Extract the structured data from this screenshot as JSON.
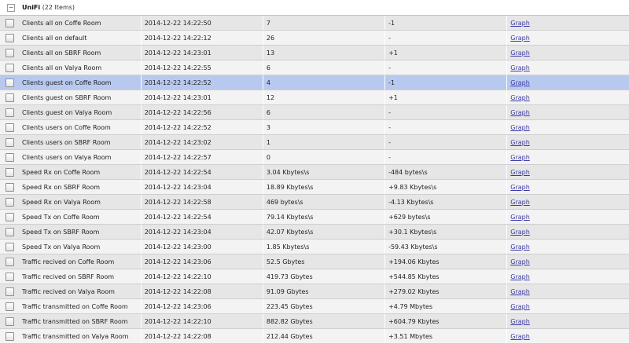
{
  "group": {
    "expander_glyph": "−",
    "title": "UniFi",
    "count_label": "(22 Items)"
  },
  "rows": [
    {
      "name": "Clients all on Coffe Room",
      "time": "2014-12-22 14:22:50",
      "value": "7",
      "change": "-1",
      "link": "Graph"
    },
    {
      "name": "Clients all on default",
      "time": "2014-12-22 14:22:12",
      "value": "26",
      "change": "-",
      "link": "Graph"
    },
    {
      "name": "Clients all on SBRF Room",
      "time": "2014-12-22 14:23:01",
      "value": "13",
      "change": "+1",
      "link": "Graph"
    },
    {
      "name": "Clients all on Valya Room",
      "time": "2014-12-22 14:22:55",
      "value": "6",
      "change": "-",
      "link": "Graph"
    },
    {
      "name": "Clients guest on Coffe Room",
      "time": "2014-12-22 14:22:52",
      "value": "4",
      "change": "-1",
      "link": "Graph",
      "selected": true
    },
    {
      "name": "Clients guest on SBRF Room",
      "time": "2014-12-22 14:23:01",
      "value": "12",
      "change": "+1",
      "link": "Graph"
    },
    {
      "name": "Clients guest on Valya Room",
      "time": "2014-12-22 14:22:56",
      "value": "6",
      "change": "-",
      "link": "Graph"
    },
    {
      "name": "Clients users on Coffe Room",
      "time": "2014-12-22 14:22:52",
      "value": "3",
      "change": "-",
      "link": "Graph"
    },
    {
      "name": "Clients users on SBRF Room",
      "time": "2014-12-22 14:23:02",
      "value": "1",
      "change": "-",
      "link": "Graph"
    },
    {
      "name": "Clients users on Valya Room",
      "time": "2014-12-22 14:22:57",
      "value": "0",
      "change": "-",
      "link": "Graph"
    },
    {
      "name": "Speed Rx on Coffe Room",
      "time": "2014-12-22 14:22:54",
      "value": "3.04 Kbytes\\s",
      "change": "-484 bytes\\s",
      "link": "Graph"
    },
    {
      "name": "Speed Rx on SBRF Room",
      "time": "2014-12-22 14:23:04",
      "value": "18.89 Kbytes\\s",
      "change": "+9.83 Kbytes\\s",
      "link": "Graph"
    },
    {
      "name": "Speed Rx on Valya Room",
      "time": "2014-12-22 14:22:58",
      "value": "469 bytes\\s",
      "change": "-4.13 Kbytes\\s",
      "link": "Graph"
    },
    {
      "name": "Speed Tx on Coffe Room",
      "time": "2014-12-22 14:22:54",
      "value": "79.14 Kbytes\\s",
      "change": "+629 bytes\\s",
      "link": "Graph"
    },
    {
      "name": "Speed Tx on SBRF Room",
      "time": "2014-12-22 14:23:04",
      "value": "42.07 Kbytes\\s",
      "change": "+30.1 Kbytes\\s",
      "link": "Graph"
    },
    {
      "name": "Speed Tx on Valya Room",
      "time": "2014-12-22 14:23:00",
      "value": "1.85 Kbytes\\s",
      "change": "-59.43 Kbytes\\s",
      "link": "Graph"
    },
    {
      "name": "Traffic recived on Coffe Room",
      "time": "2014-12-22 14:23:06",
      "value": "52.5 Gbytes",
      "change": "+194.06 Kbytes",
      "link": "Graph"
    },
    {
      "name": "Traffic recived on SBRF Room",
      "time": "2014-12-22 14:22:10",
      "value": "419.73 Gbytes",
      "change": "+544.85 Kbytes",
      "link": "Graph"
    },
    {
      "name": "Traffic recived on Valya Room",
      "time": "2014-12-22 14:22:08",
      "value": "91.09 Gbytes",
      "change": "+279.02 Kbytes",
      "link": "Graph"
    },
    {
      "name": "Traffic transmitted on Coffe Room",
      "time": "2014-12-22 14:23:06",
      "value": "223.45 Gbytes",
      "change": "+4.79 Mbytes",
      "link": "Graph"
    },
    {
      "name": "Traffic transmitted on SBRF Room",
      "time": "2014-12-22 14:22:10",
      "value": "882.82 Gbytes",
      "change": "+604.79 Kbytes",
      "link": "Graph"
    },
    {
      "name": "Traffic transmitted on Valya Room",
      "time": "2014-12-22 14:22:08",
      "value": "212.44 Gbytes",
      "change": "+3.51 Mbytes",
      "link": "Graph"
    }
  ]
}
